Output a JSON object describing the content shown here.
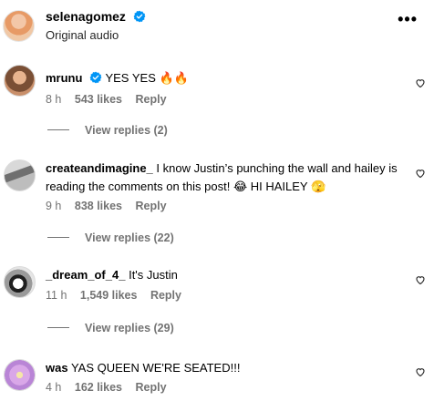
{
  "post": {
    "username": "selenagomez",
    "subtitle": "Original audio",
    "verified_icon": "verified-badge-icon",
    "more_icon": "more-horizontal-icon"
  },
  "comments": [
    {
      "username": "mrunu",
      "verified": true,
      "text": "YES YES 🔥🔥",
      "time": "8 h",
      "likes": "543 likes",
      "reply_label": "Reply",
      "view_replies": "View replies (2)"
    },
    {
      "username": "createandimagine_",
      "verified": false,
      "text": "I know Justin’s punching the wall and hailey is reading the comments on this post! 😂 HI HAILEY 🫣",
      "time": "9 h",
      "likes": "838 likes",
      "reply_label": "Reply",
      "view_replies": "View replies (22)"
    },
    {
      "username": "_dream_of_4_",
      "verified": false,
      "text": "It's Justin",
      "time": "11 h",
      "likes": "1,549 likes",
      "reply_label": "Reply",
      "view_replies": "View replies (29)"
    },
    {
      "username": "was",
      "verified": false,
      "text": "YAS QUEEN WE'RE SEATED!!!",
      "time": "4 h",
      "likes": "162 likes",
      "reply_label": "Reply",
      "view_replies": ""
    }
  ],
  "colors": {
    "verified_blue": "#0095f6",
    "muted_text": "#737373"
  },
  "icons": {
    "like": "heart-outline-icon"
  }
}
